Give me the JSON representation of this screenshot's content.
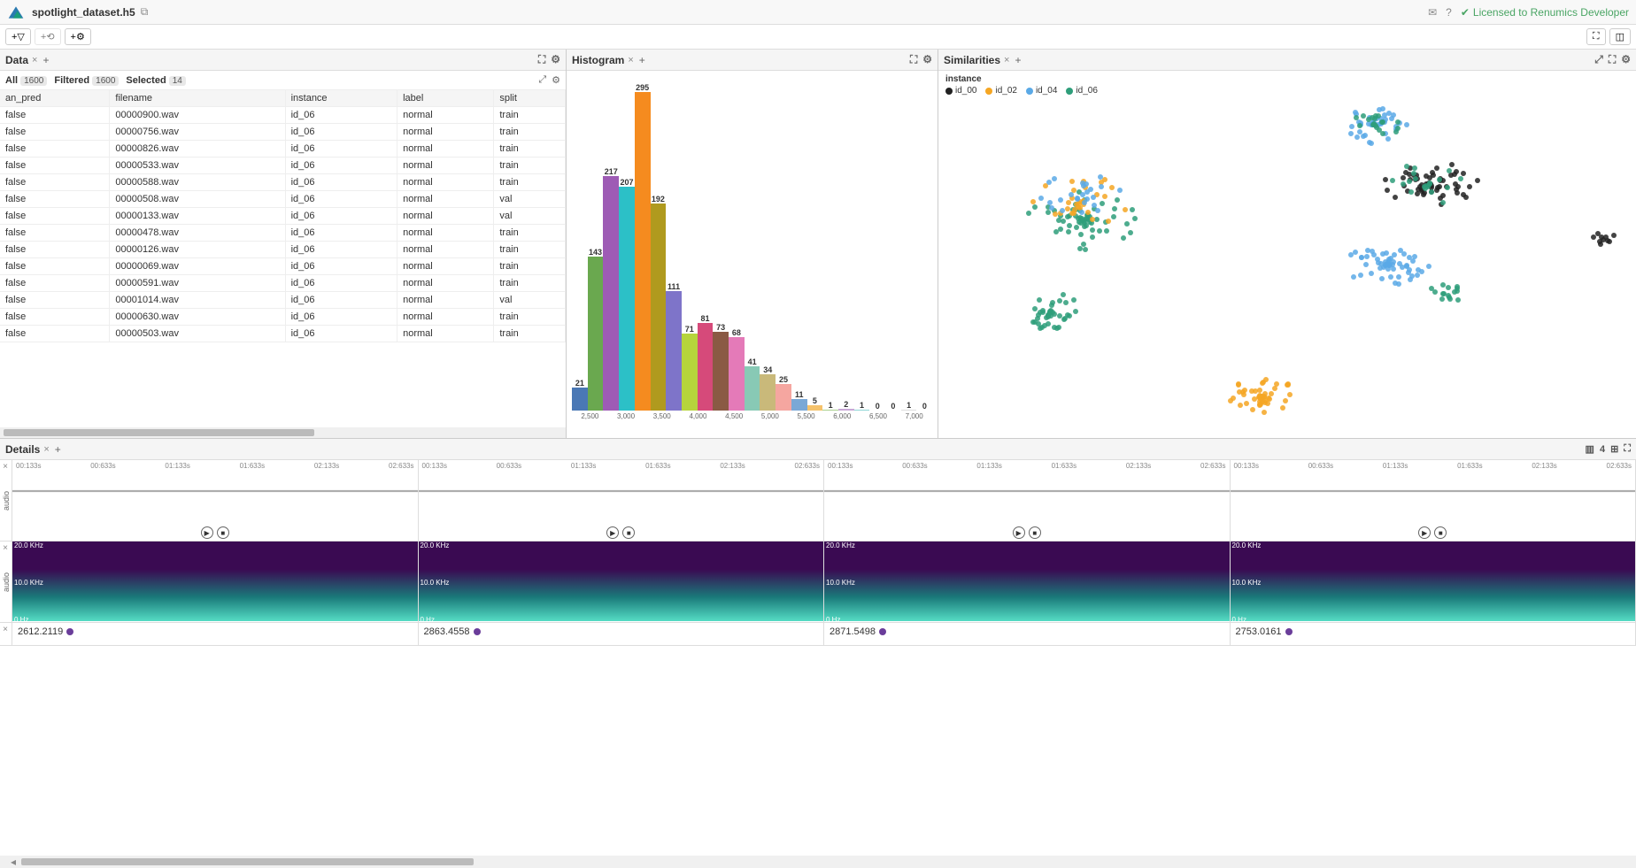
{
  "header": {
    "filename": "spotlight_dataset.h5",
    "license_text": "Licensed to Renumics Developer"
  },
  "data_panel": {
    "title": "Data",
    "all_label": "All",
    "all_count": "1600",
    "filtered_label": "Filtered",
    "filtered_count": "1600",
    "selected_label": "Selected",
    "selected_count": "14",
    "columns": [
      "an_pred",
      "filename",
      "instance",
      "label",
      "split"
    ],
    "rows": [
      [
        "false",
        "00000900.wav",
        "id_06",
        "normal",
        "train"
      ],
      [
        "false",
        "00000756.wav",
        "id_06",
        "normal",
        "train"
      ],
      [
        "false",
        "00000826.wav",
        "id_06",
        "normal",
        "train"
      ],
      [
        "false",
        "00000533.wav",
        "id_06",
        "normal",
        "train"
      ],
      [
        "false",
        "00000588.wav",
        "id_06",
        "normal",
        "train"
      ],
      [
        "false",
        "00000508.wav",
        "id_06",
        "normal",
        "val"
      ],
      [
        "false",
        "00000133.wav",
        "id_06",
        "normal",
        "val"
      ],
      [
        "false",
        "00000478.wav",
        "id_06",
        "normal",
        "train"
      ],
      [
        "false",
        "00000126.wav",
        "id_06",
        "normal",
        "train"
      ],
      [
        "false",
        "00000069.wav",
        "id_06",
        "normal",
        "train"
      ],
      [
        "false",
        "00000591.wav",
        "id_06",
        "normal",
        "train"
      ],
      [
        "false",
        "00001014.wav",
        "id_06",
        "normal",
        "val"
      ],
      [
        "false",
        "00000630.wav",
        "id_06",
        "normal",
        "train"
      ],
      [
        "false",
        "00000503.wav",
        "id_06",
        "normal",
        "train"
      ]
    ]
  },
  "histogram": {
    "title": "Histogram"
  },
  "chart_data": {
    "type": "bar",
    "title": "Histogram",
    "x_ticks": [
      "2,500",
      "3,000",
      "3,500",
      "4,000",
      "4,500",
      "5,000",
      "5,500",
      "6,000",
      "6,500",
      "7,000"
    ],
    "xlim": [
      2500,
      7000
    ],
    "ylim": [
      0,
      300
    ],
    "bars": [
      {
        "value": 21,
        "color": "#4a78b5"
      },
      {
        "value": 143,
        "color": "#6aa84f"
      },
      {
        "value": 217,
        "color": "#9e5bb5"
      },
      {
        "value": 207,
        "color": "#2cc0c7"
      },
      {
        "value": 295,
        "color": "#f58b1f"
      },
      {
        "value": 192,
        "color": "#b09a1e"
      },
      {
        "value": 111,
        "color": "#7e74c9"
      },
      {
        "value": 71,
        "color": "#b6d43c"
      },
      {
        "value": 81,
        "color": "#d64a7a"
      },
      {
        "value": 73,
        "color": "#8a5a44"
      },
      {
        "value": 68,
        "color": "#e47ab8"
      },
      {
        "value": 41,
        "color": "#88c9b5"
      },
      {
        "value": 34,
        "color": "#c9b97a"
      },
      {
        "value": 25,
        "color": "#f5a6a0"
      },
      {
        "value": 11,
        "color": "#7aa8d6"
      },
      {
        "value": 5,
        "color": "#f5c26b"
      },
      {
        "value": 1,
        "color": "#a8d08d"
      },
      {
        "value": 2,
        "color": "#c9a8d6"
      },
      {
        "value": 1,
        "color": "#8dd6d6"
      },
      {
        "value": 0,
        "color": "#ddd"
      },
      {
        "value": 0,
        "color": "#ddd"
      },
      {
        "value": 1,
        "color": "#ddd"
      },
      {
        "value": 0,
        "color": "#ddd"
      }
    ]
  },
  "similarities": {
    "title": "Similarities",
    "legend_title": "instance",
    "legend": [
      {
        "label": "id_00",
        "color": "#222"
      },
      {
        "label": "id_02",
        "color": "#f5a623"
      },
      {
        "label": "id_04",
        "color": "#5aa9e6"
      },
      {
        "label": "id_06",
        "color": "#2e9e7a"
      }
    ]
  },
  "details": {
    "title": "Details",
    "col_count_label": "4",
    "row_labels": {
      "audio1": "audio",
      "audio2": "audio"
    },
    "freq_labels": {
      "top": "20.0 KHz",
      "mid": "10.0 KHz",
      "bot": "0 Hz"
    },
    "time_ticks": [
      "00:133s",
      "00:633s",
      "01:133s",
      "01:633s",
      "02:133s",
      "02:633s"
    ],
    "scalars": [
      "2612.2119",
      "2863.4558",
      "2871.5498",
      "2753.0161"
    ]
  }
}
